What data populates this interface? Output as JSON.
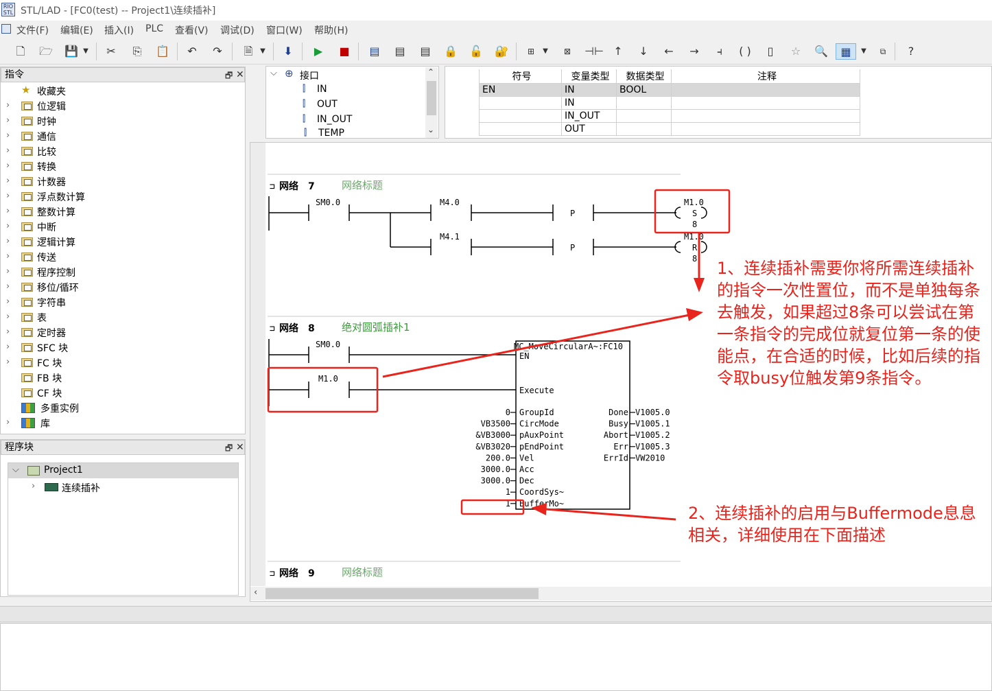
{
  "window": {
    "title": "STL/LAD - [FC0(test) -- Project1\\连续插补]",
    "icon_text": "RIO\nSTL"
  },
  "menu": [
    "文件(F)",
    "编辑(E)",
    "插入(I)",
    "PLC",
    "查看(V)",
    "调试(D)",
    "窗口(W)",
    "帮助(H)"
  ],
  "instructions_panel": {
    "title": "指令",
    "items": [
      "收藏夹",
      "位逻辑",
      "时钟",
      "通信",
      "比较",
      "转换",
      "计数器",
      "浮点数计算",
      "整数计算",
      "中断",
      "逻辑计算",
      "传送",
      "程序控制",
      "移位/循环",
      "字符串",
      "表",
      "定时器",
      "SFC 块",
      "FC 块",
      "FB 块",
      "CF 块",
      "多重实例",
      "库"
    ]
  },
  "program_panel": {
    "title": "程序块",
    "project": "Project1",
    "child": "连续插补"
  },
  "interface_tree": {
    "root": "接口",
    "items": [
      "IN",
      "OUT",
      "IN_OUT",
      "TEMP"
    ]
  },
  "var_table": {
    "headers": [
      "符号",
      "变量类型",
      "数据类型",
      "注释"
    ],
    "rows": [
      [
        "EN",
        "IN",
        "BOOL",
        ""
      ],
      [
        "",
        "IN",
        "",
        ""
      ],
      [
        "",
        "IN_OUT",
        "",
        ""
      ],
      [
        "",
        "OUT",
        "",
        ""
      ]
    ]
  },
  "networks": [
    {
      "label": "网络",
      "number": "7",
      "title": "网络标题"
    },
    {
      "label": "网络",
      "number": "8",
      "title": "绝对圆弧插补1"
    },
    {
      "label": "网络",
      "number": "9",
      "title": "网络标题"
    }
  ],
  "net7": {
    "contact1": "SM0.0",
    "contact2": "M4.0",
    "contact3": "M4.1",
    "p": "P",
    "coil_set_addr": "M1.0",
    "coil_set_type": "S",
    "coil_set_n": "8",
    "coil_reset_addr": "M1.0",
    "coil_reset_type": "R",
    "coil_reset_n": "8"
  },
  "net8": {
    "contact1": "SM0.0",
    "contact2": "M1.0",
    "block_name": "MC_MoveCircularA~:FC10",
    "en": "EN",
    "execute": "Execute",
    "inputs": [
      {
        "value": "0",
        "pin": "GroupId"
      },
      {
        "value": "VB3500",
        "pin": "CircMode"
      },
      {
        "value": "&VB3000",
        "pin": "pAuxPoint"
      },
      {
        "value": "&VB3020",
        "pin": "pEndPoint"
      },
      {
        "value": "200.0",
        "pin": "Vel"
      },
      {
        "value": "3000.0",
        "pin": "Acc"
      },
      {
        "value": "3000.0",
        "pin": "Dec"
      },
      {
        "value": "1",
        "pin": "CoordSys~"
      },
      {
        "value": "1",
        "pin": "BufferMo~"
      }
    ],
    "outputs": [
      {
        "pin": "Done",
        "value": "V1005.0"
      },
      {
        "pin": "Busy",
        "value": "V1005.1"
      },
      {
        "pin": "Abort",
        "value": "V1005.2"
      },
      {
        "pin": "Err",
        "value": "V1005.3"
      },
      {
        "pin": "ErrId",
        "value": "VW2010"
      }
    ]
  },
  "annotations": {
    "note1": "1、连续插补需要你将所需连续插补的指令一次性置位，而不是单独每条去触发，如果超过8条可以尝试在第一条指令的完成位就复位第一条的使能点，在合适的时候，比如后续的指令取busy位触发第9条指令。",
    "note2": "2、连续插补的启用与Buffermode息息相关，详细使用在下面描述",
    "color": "#e8241c"
  }
}
